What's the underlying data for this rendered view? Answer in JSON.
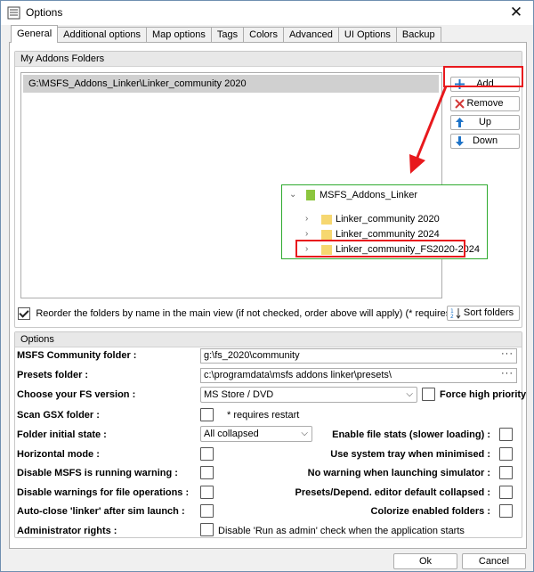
{
  "window": {
    "title": "Options",
    "close_glyph": "✕"
  },
  "tabs": [
    {
      "label": "General"
    },
    {
      "label": "Additional options"
    },
    {
      "label": "Map options"
    },
    {
      "label": "Tags"
    },
    {
      "label": "Colors"
    },
    {
      "label": "Advanced"
    },
    {
      "label": "UI Options"
    },
    {
      "label": "Backup"
    }
  ],
  "addons_group": {
    "header": "My Addons Folders",
    "folders": [
      "G:\\MSFS_Addons_Linker\\Linker_community 2020"
    ],
    "buttons": {
      "add": "Add",
      "remove": "Remove",
      "up": "Up",
      "down": "Down"
    },
    "reorder_checked": true,
    "reorder_label": "Reorder the folders by name in the main view (if not checked, order above will apply) (* requires restart)",
    "sort_button": "Sort folders"
  },
  "tree_popup": {
    "root": "MSFS_Addons_Linker",
    "children": [
      "Linker_community 2020",
      "Linker_community 2024",
      "Linker_community_FS2020-2024"
    ]
  },
  "options_group": {
    "header": "Options",
    "community_folder_label": "MSFS Community folder :",
    "community_folder_value": "g:\\fs_2020\\community",
    "presets_folder_label": "Presets folder :",
    "presets_folder_value": "c:\\programdata\\msfs addons linker\\presets\\",
    "browse_glyph": "···",
    "fs_version_label": "Choose your FS version :",
    "fs_version_value": "MS Store / DVD",
    "force_priority_label": "Force high priority",
    "scan_gsx_label": "Scan GSX folder :",
    "requires_restart_note": "* requires restart",
    "folder_state_label": "Folder initial state :",
    "folder_state_value": "All collapsed",
    "enable_file_stats_label": "Enable file stats (slower loading) :",
    "horizontal_mode_label": "Horizontal mode :",
    "system_tray_label": "Use system tray when minimised :",
    "disable_running_warning_label": "Disable MSFS is running warning :",
    "no_warning_launch_label": "No warning when launching simulator :",
    "disable_file_ops_warning_label": "Disable warnings for file operations :",
    "presets_editor_collapsed_label": "Presets/Depend. editor default collapsed :",
    "auto_close_label": "Auto-close 'linker' after sim launch :",
    "colorize_enabled_label": "Colorize enabled folders :",
    "admin_rights_label": "Administrator rights :",
    "admin_rights_note": "Disable 'Run as admin' check when the application starts"
  },
  "footer": {
    "ok": "Ok",
    "cancel": "Cancel"
  },
  "colors": {
    "highlight_red": "#e8191d",
    "tree_border": "#2eaa2e",
    "folder_yellow": "#f6d770",
    "icon_blue": "#1e73c8"
  }
}
